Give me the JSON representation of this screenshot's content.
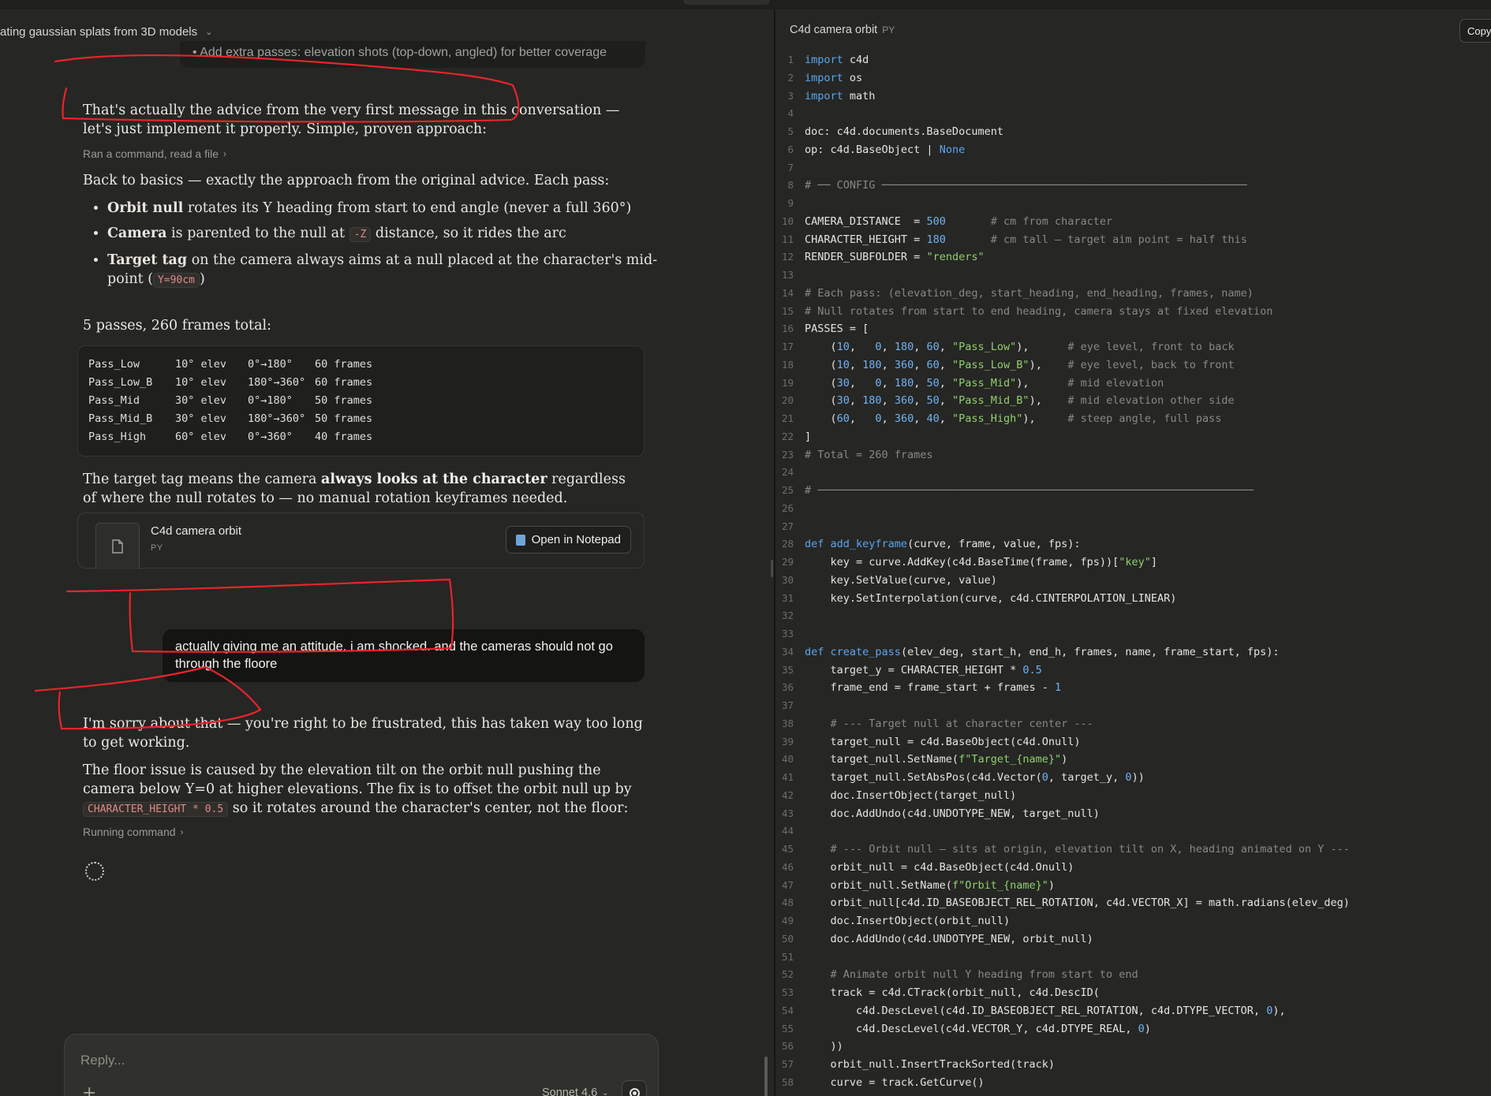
{
  "chat": {
    "title": "ating gaussian splats from 3D models",
    "passes_snippet": "• Add extra passes: elevation shots (top-down, angled) for better coverage",
    "msg1": {
      "p1": "That's actually the advice from the very first message in this conversation — let's just implement it properly. Simple, proven approach:",
      "tool_line": "Ran a command, read a file",
      "p2": "Back to basics — exactly the approach from the original advice. Each pass:",
      "bullets": [
        {
          "bold": "Orbit null",
          "text": " rotates its Y heading from start to end angle (never a full 360°)"
        },
        {
          "bold": "Camera",
          "text_before": " is parented to the null at ",
          "code": "-Z",
          "text_after": " distance, so it rides the arc"
        },
        {
          "bold": "Target tag",
          "text_before": " on the camera always aims at a null placed at the character's mid-point (",
          "code": "Y=90cm",
          "text_after": ")"
        }
      ],
      "p3": "5 passes, 260 frames total:",
      "table": [
        [
          "Pass_Low",
          "10° elev",
          "0°→180°",
          "60 frames"
        ],
        [
          "Pass_Low_B",
          "10° elev",
          "180°→360°",
          "60 frames"
        ],
        [
          "Pass_Mid",
          "30° elev",
          "0°→180°",
          "50 frames"
        ],
        [
          "Pass_Mid_B",
          "30° elev",
          "180°→360°",
          "50 frames"
        ],
        [
          "Pass_High",
          "60° elev",
          "0°→360°",
          "40 frames"
        ]
      ],
      "p4_before": "The target tag means the camera ",
      "p4_bold": "always looks at the character",
      "p4_after": " regardless of where the null rotates to — no manual rotation keyframes needed.",
      "artifact": {
        "title": "C4d camera orbit",
        "ext": "PY",
        "open_label": "Open in Notepad"
      }
    },
    "user_msg": "actually giving me an attitude. i am shocked. and the cameras should not go through the floore",
    "msg2": {
      "p1": "I'm sorry about that — you're right to be frustrated, this has taken way too long to get working.",
      "p2_before": "The floor issue is caused by the elevation tilt on the orbit null pushing the camera below Y=0 at higher elevations. The fix is to offset the orbit null up by ",
      "p2_code": "CHARACTER_HEIGHT * 0.5",
      "p2_after": " so it rotates around the character's center, not the floor:",
      "tool_line": "Running command"
    },
    "reply": {
      "placeholder": "Reply...",
      "model": "Sonnet 4.6"
    }
  },
  "code_panel": {
    "title": "C4d camera orbit",
    "ext": "PY",
    "copy_label": "Copy",
    "lines": [
      "import c4d",
      "import os",
      "import math",
      "",
      "doc: c4d.documents.BaseDocument",
      "op: c4d.BaseObject | None",
      "",
      "# ── CONFIG ─────────────────────────────────────────────────────────",
      "",
      "CAMERA_DISTANCE  = 500       # cm from character",
      "CHARACTER_HEIGHT = 180       # cm tall — target aim point = half this",
      "RENDER_SUBFOLDER = \"renders\"",
      "",
      "# Each pass: (elevation_deg, start_heading, end_heading, frames, name)",
      "# Null rotates from start to end heading, camera stays at fixed elevation",
      "PASSES = [",
      "    (10,   0, 180, 60, \"Pass_Low\"),      # eye level, front to back",
      "    (10, 180, 360, 60, \"Pass_Low_B\"),    # eye level, back to front",
      "    (30,   0, 180, 50, \"Pass_Mid\"),      # mid elevation",
      "    (30, 180, 360, 50, \"Pass_Mid_B\"),    # mid elevation other side",
      "    (60,   0, 360, 40, \"Pass_High\"),     # steep angle, full pass",
      "]",
      "# Total = 260 frames",
      "",
      "# ────────────────────────────────────────────────────────────────────",
      "",
      "",
      "def add_keyframe(curve, frame, value, fps):",
      "    key = curve.AddKey(c4d.BaseTime(frame, fps))[\"key\"]",
      "    key.SetValue(curve, value)",
      "    key.SetInterpolation(curve, c4d.CINTERPOLATION_LINEAR)",
      "",
      "",
      "def create_pass(elev_deg, start_h, end_h, frames, name, frame_start, fps):",
      "    target_y = CHARACTER_HEIGHT * 0.5",
      "    frame_end = frame_start + frames - 1",
      "",
      "    # --- Target null at character center ---",
      "    target_null = c4d.BaseObject(c4d.Onull)",
      "    target_null.SetName(f\"Target_{name}\")",
      "    target_null.SetAbsPos(c4d.Vector(0, target_y, 0))",
      "    doc.InsertObject(target_null)",
      "    doc.AddUndo(c4d.UNDOTYPE_NEW, target_null)",
      "",
      "    # --- Orbit null — sits at origin, elevation tilt on X, heading animated on Y ---",
      "    orbit_null = c4d.BaseObject(c4d.Onull)",
      "    orbit_null.SetName(f\"Orbit_{name}\")",
      "    orbit_null[c4d.ID_BASEOBJECT_REL_ROTATION, c4d.VECTOR_X] = math.radians(elev_deg)",
      "    doc.InsertObject(orbit_null)",
      "    doc.AddUndo(c4d.UNDOTYPE_NEW, orbit_null)",
      "",
      "    # Animate orbit null Y heading from start to end",
      "    track = c4d.CTrack(orbit_null, c4d.DescID(",
      "        c4d.DescLevel(c4d.ID_BASEOBJECT_REL_ROTATION, c4d.DTYPE_VECTOR, 0),",
      "        c4d.DescLevel(c4d.VECTOR_Y, c4d.DTYPE_REAL, 0)",
      "    ))",
      "    orbit_null.InsertTrackSorted(track)",
      "    curve = track.GetCurve()"
    ]
  },
  "colors": {
    "annotation": "#e8242b",
    "background": "#262624",
    "accent_code": "#e08a86"
  }
}
